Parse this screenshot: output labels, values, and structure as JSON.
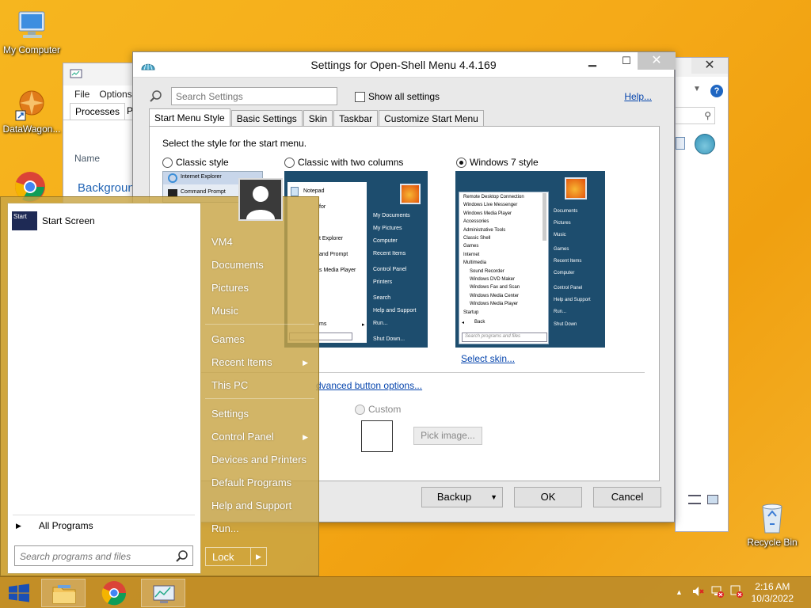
{
  "desktop": {
    "icons": [
      {
        "label": "My Computer"
      },
      {
        "label": "DataWagon..."
      },
      {
        "label": "Recycle Bin"
      }
    ]
  },
  "taskmgr": {
    "menu": [
      "File",
      "Options"
    ],
    "tabs": [
      "Processes",
      "Pe"
    ],
    "name_col": "Name",
    "group_label": "Backgroun"
  },
  "dialog": {
    "title": "Settings for Open-Shell Menu 4.4.169",
    "search_placeholder": "Search Settings",
    "show_all": "Show all settings",
    "help": "Help...",
    "tabs": [
      "Start Menu Style",
      "Basic Settings",
      "Skin",
      "Taskbar",
      "Customize Start Menu"
    ],
    "heading": "Select the style for the start menu.",
    "styles": [
      {
        "label": "Classic style",
        "selected": false
      },
      {
        "label": "Classic with two columns",
        "selected": false
      },
      {
        "label": "Windows 7 style",
        "selected": true
      }
    ],
    "preview_classic": [
      "Internet Explorer",
      "Command Prompt"
    ],
    "preview_two_col_left": [
      "Notepad",
      "for",
      "t Explorer",
      "and Prompt",
      "s Media Player",
      "ms"
    ],
    "preview_two_col_right": [
      "My Documents",
      "My Pictures",
      "Computer",
      "Recent Items",
      "Control Panel",
      "Printers",
      "Search",
      "Help and Support",
      "Run...",
      "Shut Down..."
    ],
    "preview_win7_left": [
      "Remote Desktop Connection",
      "Windows Live Messenger",
      "Windows Media Player",
      "Accessories",
      "Administrative Tools",
      "Classic Shell",
      "Games",
      "Internet",
      "Multimedia",
      "Sound Recorder",
      "Windows DVD Maker",
      "Windows Fax and Scan",
      "Windows Media Center",
      "Windows Media Player",
      "Startup"
    ],
    "preview_win7_back": "Back",
    "preview_win7_search": "Search programs and files",
    "preview_win7_right": [
      "Documents",
      "Pictures",
      "Music",
      "Games",
      "Recent Items",
      "Computer",
      "Control Panel",
      "Help and Support",
      "Run...",
      "Shut Down"
    ],
    "select_skin": "Select skin...",
    "advanced": "dvanced button options...",
    "custom": "Custom",
    "pick_image": "Pick image...",
    "backup": "Backup",
    "ok": "OK",
    "cancel": "Cancel"
  },
  "startmenu": {
    "start_tile": "Start",
    "start_screen": "Start Screen",
    "all_programs": "All Programs",
    "search_placeholder": "Search programs and files",
    "right_items": [
      "VM4",
      "Documents",
      "Pictures",
      "Music",
      "Games",
      "Recent Items",
      "This PC",
      "Settings",
      "Control Panel",
      "Devices and Printers",
      "Default Programs",
      "Help and Support",
      "Run..."
    ],
    "lock": "Lock"
  },
  "taskbar": {
    "time": "2:16 AM",
    "date": "10/3/2022"
  },
  "colors": {
    "desktop": "#f5aa18",
    "startmenu": "#c8a546",
    "link": "#0645ad",
    "win7_panel": "#1d4d6e"
  }
}
